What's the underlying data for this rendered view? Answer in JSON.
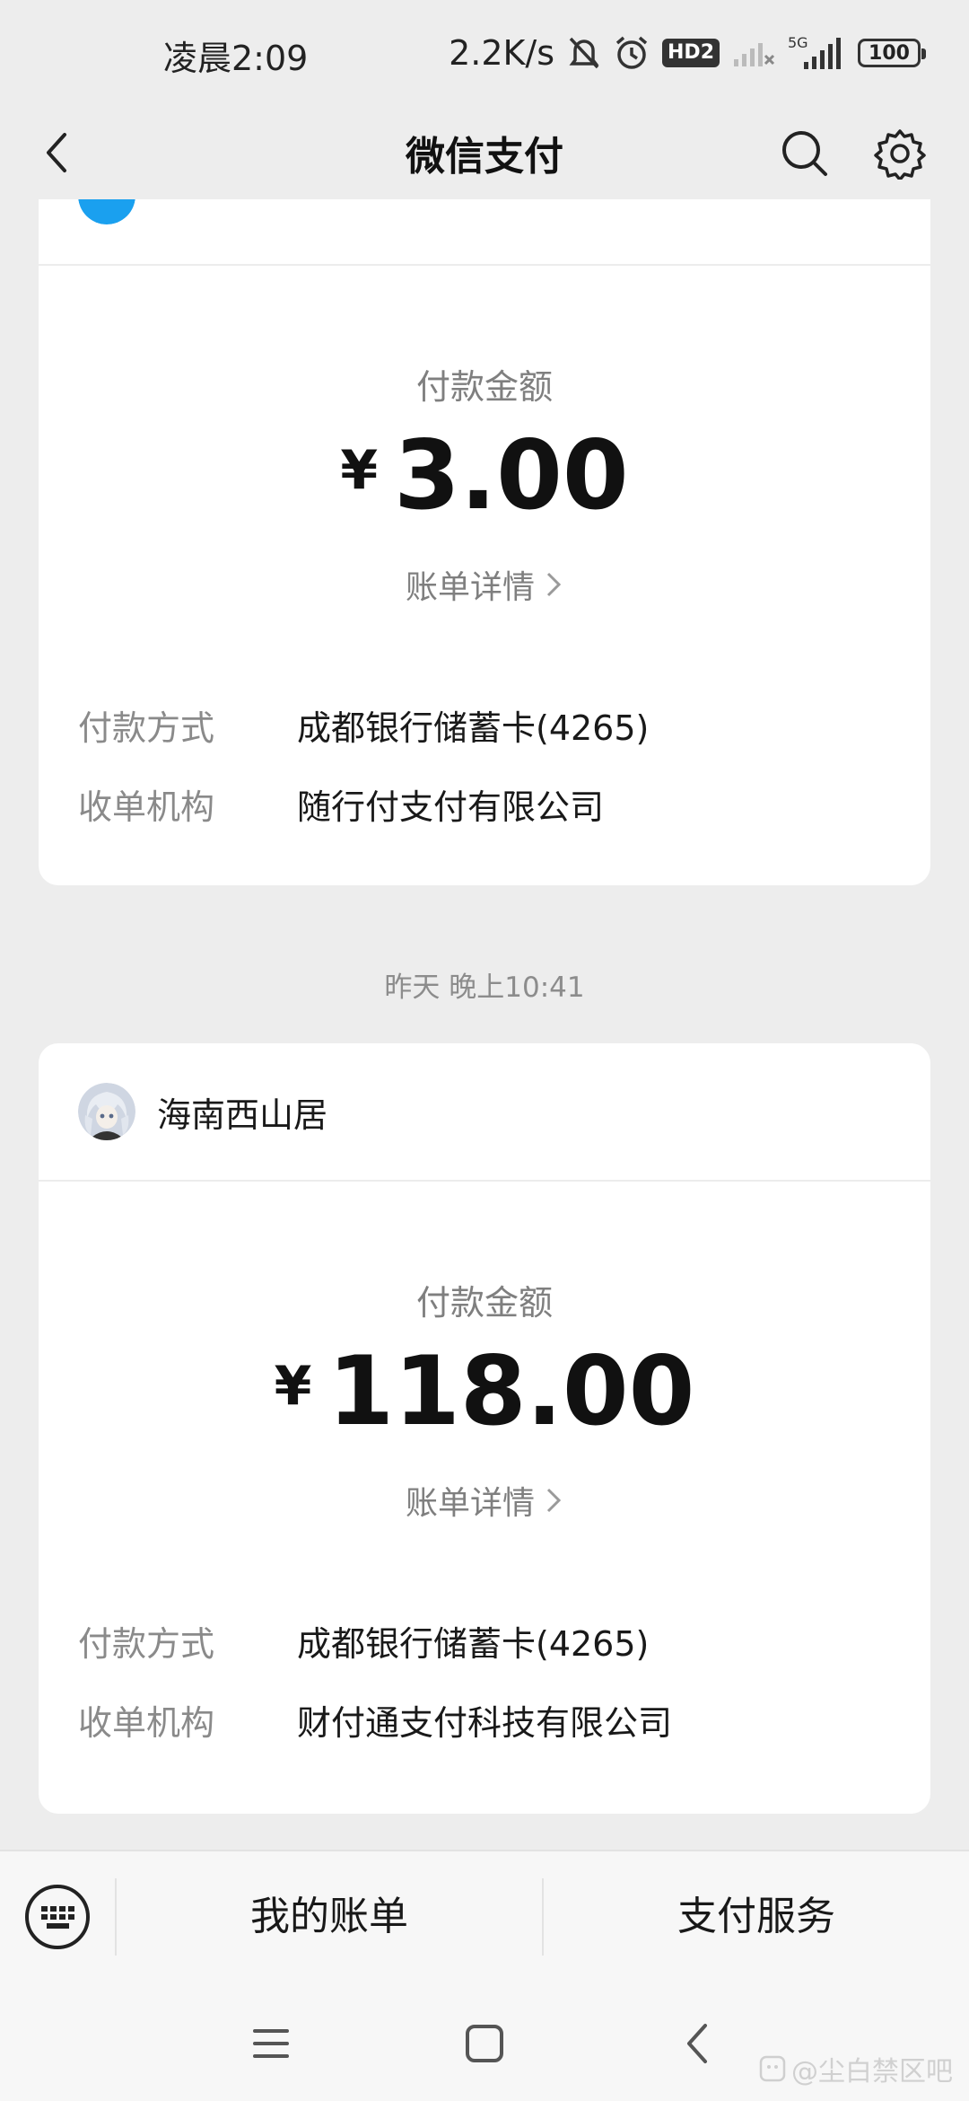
{
  "status_bar": {
    "time": "凌晨2:09",
    "net_speed": "2.2K/s",
    "hd_label": "HD2",
    "network": "5G",
    "battery": "100"
  },
  "header": {
    "title": "微信支付"
  },
  "cards": [
    {
      "amount_label": "付款金额",
      "currency": "¥",
      "amount": "3.00",
      "detail_link": "账单详情",
      "rows": [
        {
          "label": "付款方式",
          "value": "成都银行储蓄卡(4265)"
        },
        {
          "label": "收单机构",
          "value": "随行付支付有限公司"
        }
      ]
    },
    {
      "merchant": "海南西山居",
      "amount_label": "付款金额",
      "currency": "¥",
      "amount": "118.00",
      "detail_link": "账单详情",
      "rows": [
        {
          "label": "付款方式",
          "value": "成都银行储蓄卡(4265)"
        },
        {
          "label": "收单机构",
          "value": "财付通支付科技有限公司"
        }
      ]
    }
  ],
  "timestamp": "昨天 晚上10:41",
  "bottom_menu": {
    "items": [
      "我的账单",
      "支付服务"
    ]
  },
  "watermark": "@尘白禁区吧",
  "colors": {
    "background": "#ededed",
    "card": "#ffffff",
    "avatar_blue": "#1aa0ef"
  }
}
